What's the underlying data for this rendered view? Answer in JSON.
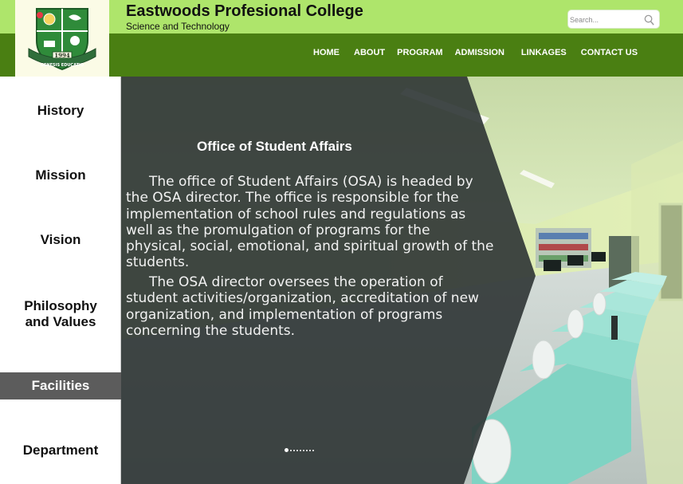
{
  "header": {
    "college_name": "Eastwoods Profesional College",
    "college_subtitle": "Science and Technology",
    "logo": {
      "year": "1994",
      "motto": "GENESIS EDUCATIO"
    }
  },
  "search": {
    "placeholder": "Search..."
  },
  "nav": {
    "items": [
      {
        "label": "HOME"
      },
      {
        "label": "ABOUT"
      },
      {
        "label": "PROGRAM"
      },
      {
        "label": "ADMISSION"
      },
      {
        "label": "LINKAGES"
      },
      {
        "label": "CONTACT US"
      }
    ]
  },
  "sidebar": {
    "items": [
      {
        "label": "History"
      },
      {
        "label": "Mission"
      },
      {
        "label": "Vision"
      },
      {
        "label": "Philosophy and Values"
      },
      {
        "label": "Facilities"
      },
      {
        "label": "Department"
      }
    ],
    "active": "Facilities"
  },
  "content": {
    "title": "Office of Student Affairs",
    "paragraphs": [
      "The office of Student Affairs (OSA) is headed by the OSA director. The office is responsible for the implementation of school rules and regulations as well as the promulgation of programs for the physical, social, emotional, and spiritual growth of the students.",
      "The OSA director oversees the operation of student activities/organization, accreditation of new organization, and implementation of programs concerning the students."
    ]
  },
  "carousel": {
    "total": 9,
    "active_index": 0
  },
  "colors": {
    "header_light": "#aee56b",
    "header_dark": "#4a7f12",
    "sidebar_active": "#5c5c5c",
    "panel_dark": "#2e3434"
  }
}
